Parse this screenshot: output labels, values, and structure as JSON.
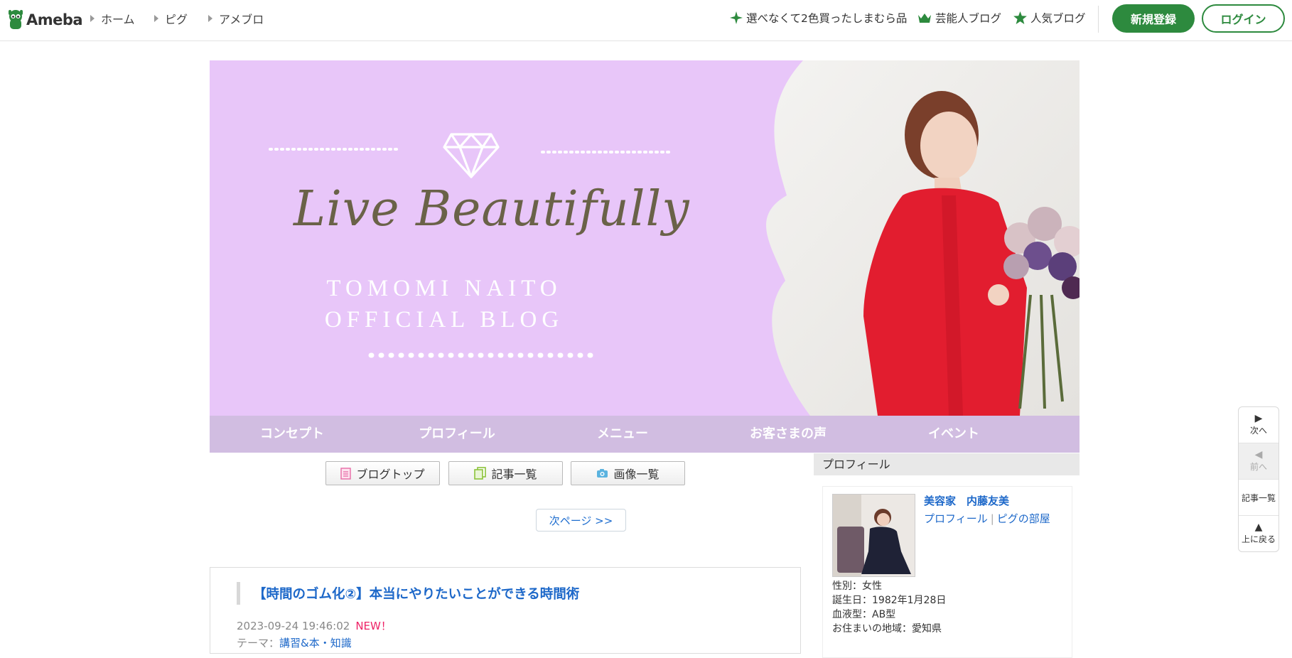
{
  "header": {
    "logo_text": "Ameba",
    "breadcrumbs": [
      "ホーム",
      "ピグ",
      "アメブロ"
    ],
    "links": [
      "選べなくて2色買ったしまむら品",
      "芸能人ブログ",
      "人気ブログ"
    ],
    "register_label": "新規登録",
    "login_label": "ログイン",
    "colors": {
      "brand_green": "#2d8a3e"
    }
  },
  "banner": {
    "script_title": "Live Beautifully",
    "subtitle_line1": "TOMOMI NAITO",
    "subtitle_line2": "OFFICIAL BLOG",
    "colors": {
      "background": "#e8c6f9",
      "title": "#6a6248"
    }
  },
  "global_nav": [
    "コンセプト",
    "プロフィール",
    "メニュー",
    "お客さまの声",
    "イベント"
  ],
  "main": {
    "buttons": [
      "ブログトップ",
      "記事一覧",
      "画像一覧"
    ],
    "next_page": "次ページ >>",
    "article": {
      "title": "【時間のゴム化②】本当にやりたいことができる時間術",
      "date": "2023-09-24 19:46:02",
      "new_badge": "NEW！",
      "theme_label": "テーマ：",
      "theme_value": "講習&本・知識"
    }
  },
  "sidebar": {
    "heading": "プロフィール",
    "name": "美容家　内藤友美",
    "link_profile": "プロフィール",
    "link_pigg": "ピグの部屋",
    "info": [
      "性別：女性",
      "誕生日：1982年1月28日",
      "血液型：AB型",
      "お住まいの地域：愛知県"
    ]
  },
  "float_nav": {
    "next": "次へ",
    "prev": "前へ",
    "list": "記事一覧",
    "top": "上に戻る"
  }
}
